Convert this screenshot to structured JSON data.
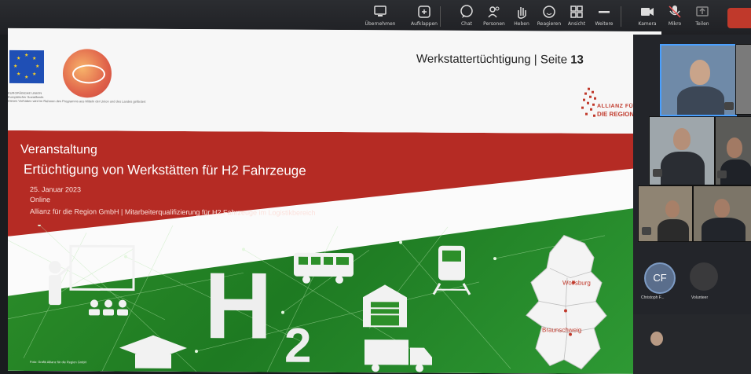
{
  "toolbar": {
    "buttons": [
      {
        "label": "Übernehmen",
        "icon": "screen-share-icon"
      },
      {
        "label": "Aufklappen",
        "icon": "expand-icon"
      },
      {
        "label": "Chat",
        "icon": "chat-icon"
      },
      {
        "label": "Personen",
        "icon": "people-icon"
      },
      {
        "label": "Heben",
        "icon": "raise-hand-icon"
      },
      {
        "label": "Reagieren",
        "icon": "reaction-icon"
      },
      {
        "label": "Ansicht",
        "icon": "view-grid-icon"
      },
      {
        "label": "Weitere",
        "icon": "more-icon"
      },
      {
        "label": "Kamera",
        "icon": "camera-icon"
      },
      {
        "label": "Mikro",
        "icon": "microphone-icon"
      },
      {
        "label": "Teilen",
        "icon": "share-icon"
      }
    ],
    "colors": {
      "bar": "#222428",
      "leave": "#c0392b"
    }
  },
  "slide": {
    "pagination_label": "Werkstattertüchtigung | Seite ",
    "page_number": "13",
    "eu_caption_line1": "EUROPÄISCHE UNION",
    "eu_caption_line2": "Europäischer Sozialfonds",
    "eu_caption_line3": "Dieses Vorhaben wird im Rahmen des Programms aus Mitteln der Union und des Landes gefördert",
    "allianz_line1": "ALLIANZ FÜR",
    "allianz_line2": "DIE REGION",
    "event_label": "Veranstaltung",
    "event_title": "Ertüchtigung von Werkstätten für H2 Fahrzeuge",
    "date": "25. Januar 2023",
    "format": "Online",
    "organizer": "Allianz für die Region GmbH | Mitarbeiterqualifizierung für H2 Fahrzeuge im Logistikbereich",
    "h2_main": "H",
    "h2_sub": "2",
    "map_city_1": "Wolfsburg",
    "map_city_2": "Braunschweig",
    "photo_credit": "Foto: Grafik Allianz für die Region GmbH",
    "colors": {
      "red_band": "#b52b24",
      "green": "#2d8f2a",
      "eu_blue": "#1f4fb5"
    }
  },
  "participants": {
    "avatar_initials": "CF",
    "avatar_name": "Christoph F...",
    "avatar2_name": "Volunteer"
  }
}
